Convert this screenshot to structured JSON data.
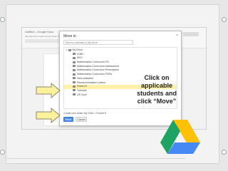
{
  "dialog": {
    "title": "Move to",
    "close_glyph": "×",
    "move_into_text": "Move to selected: ▸ My Drive",
    "tree": [
      {
        "label": "My Drive",
        "root": true,
        "selected": false
      },
      {
        "label": "ICBN",
        "selected": false
      },
      {
        "label": "MVC",
        "selected": false
      },
      {
        "label": "Mathematics Curriculum P.6",
        "selected": false
      },
      {
        "label": "Mathematics Curriculum Assessment",
        "selected": false
      },
      {
        "label": "Mathematics Curriculum Prescription",
        "selected": false
      },
      {
        "label": "Mathematics Curriculum FDRs",
        "selected": false
      },
      {
        "label": "New collection",
        "selected": false
      },
      {
        "label": "Recommendation Letters",
        "selected": false
      },
      {
        "label": "Robert E",
        "selected": true
      },
      {
        "label": "Tutorials",
        "selected": false
      },
      {
        "label": "US Govt",
        "selected": false
      }
    ],
    "create_folder_text": "Create new folder  My Drive > Robert E",
    "move_label": "Move",
    "cancel_label": "Cancel"
  },
  "background_app": {
    "title_text": "Untitled - Google Docs",
    "menu_text": "File  Edit  View  Insert  Format  Tools  Table  Help"
  },
  "instruction": {
    "line1": "Click on",
    "line2": "applicable",
    "line3": "students and",
    "line4": "click “Move”"
  },
  "colors": {
    "arrow_fill": "#fbf19a",
    "arrow_stroke": "#8c8570",
    "selected_row": "#fff2a8",
    "move_button": "#4d8ee8",
    "drive_green": "#1ea362",
    "drive_yellow": "#ffc107",
    "drive_blue": "#4688f4"
  },
  "icons": [
    "google-drive-icon",
    "arrow-icon",
    "folder-icon",
    "close-icon"
  ]
}
